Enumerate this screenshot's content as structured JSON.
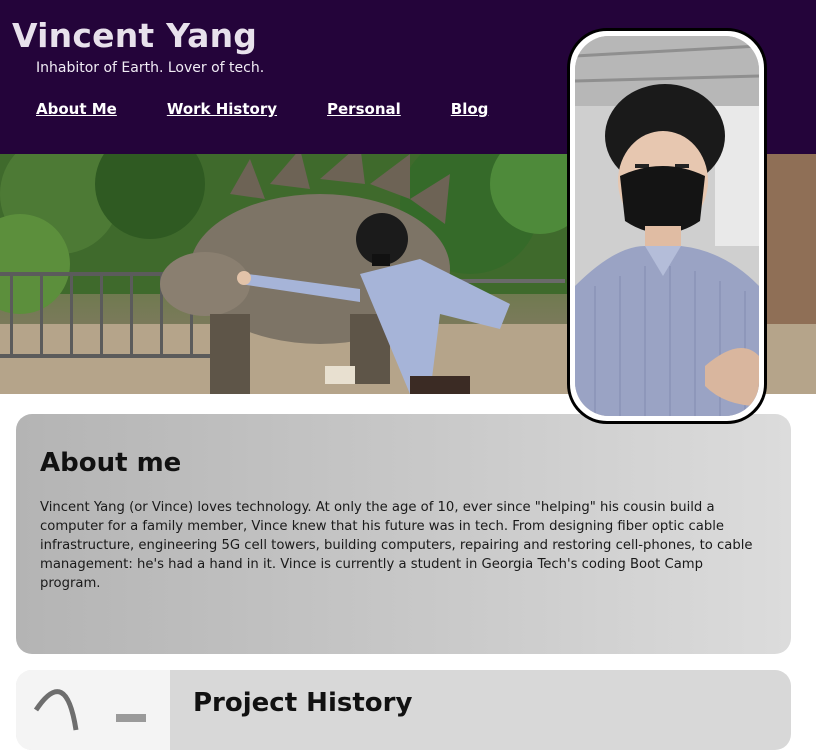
{
  "header": {
    "title": "Vincent Yang",
    "subtitle": "Inhabitor of Earth. Lover of tech.",
    "nav": [
      {
        "label": "About Me"
      },
      {
        "label": "Work History"
      },
      {
        "label": "Personal"
      },
      {
        "label": "Blog"
      }
    ]
  },
  "about": {
    "title": "About me",
    "text": "Vincent Yang (or Vince) loves technology. At only the age of 10, ever since \"helping\" his cousin build a computer for a family member, Vince knew that his future was in tech. From designing fiber optic cable infrastructure, engineering 5G cell towers, building computers, repairing and restoring cell-phones, to cable management: he's had a hand in it. Vince is currently a student in Georgia Tech's coding Boot Camp program."
  },
  "projects": {
    "title": "Project History"
  },
  "colors": {
    "header_bg": "#24043a",
    "card_bg": "#c9c9c9"
  }
}
